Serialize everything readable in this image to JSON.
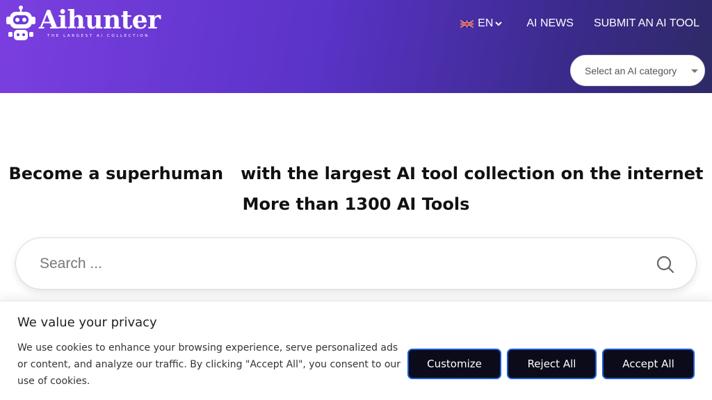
{
  "brand": {
    "name": "Aihunter",
    "tagline": "THE LARGEST AI COLLECTION",
    "gradient": [
      "#7b3fe0",
      "#2e2a66"
    ]
  },
  "nav": {
    "language": {
      "code": "EN",
      "flag_icon": "uk-flag-icon",
      "chevron_icon": "chevron-down-icon"
    },
    "links": [
      {
        "label": "AI NEWS"
      },
      {
        "label": "SUBMIT AN AI TOOL"
      }
    ],
    "category_select": {
      "selected": "Select an AI category",
      "icon": "caret-down-icon"
    }
  },
  "hero": {
    "line1": "Become a superhuman   with the largest AI tool collection on the internet",
    "line2": "More than 1300 AI Tools"
  },
  "search": {
    "placeholder": "Search ...",
    "value": "",
    "icon": "search-icon"
  },
  "cookie_banner": {
    "title": "We value your privacy",
    "text": "We use cookies to enhance your browsing experience, serve personalized ads or content, and analyze our traffic. By clicking \"Accept All\", you consent to our use of cookies.",
    "buttons": {
      "customize": "Customize",
      "reject": "Reject All",
      "accept": "Accept All"
    },
    "button_color": "#0b0b1a",
    "button_border": "#1d5bd6"
  }
}
